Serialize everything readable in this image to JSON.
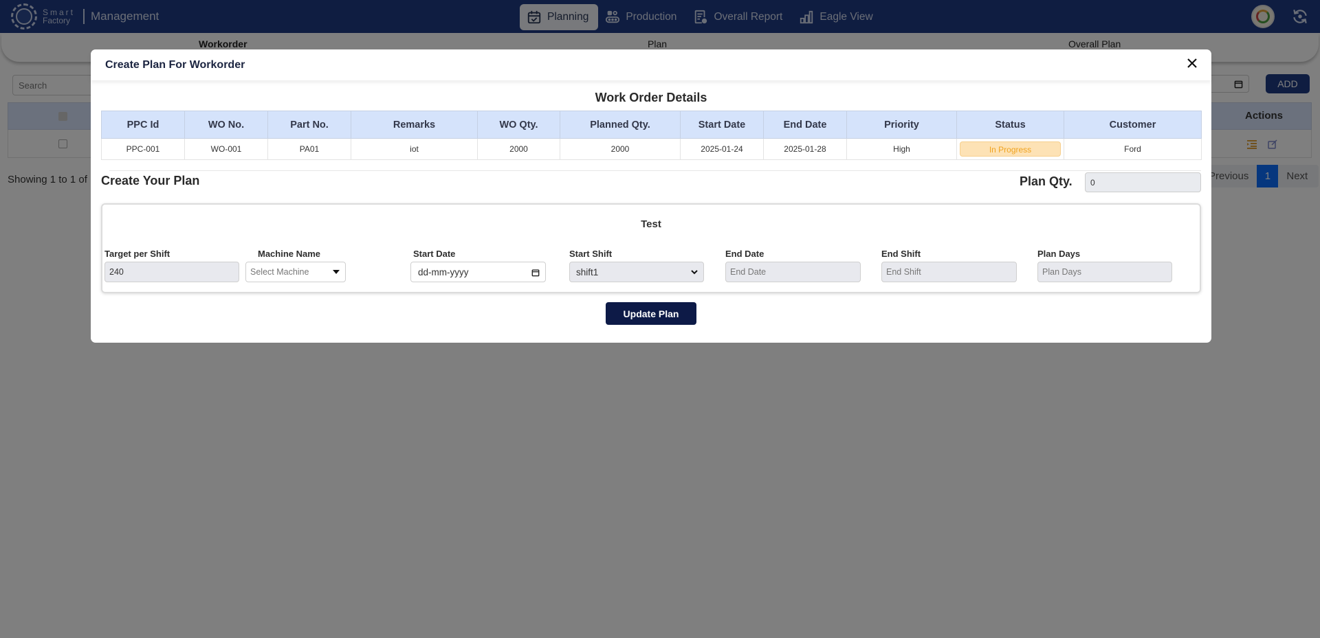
{
  "navbar": {
    "brand_line1": "Smart",
    "brand_line2": "Factory",
    "title": "Management",
    "tabs": [
      {
        "label": "Planning",
        "icon": "calendar-check-icon",
        "active": true
      },
      {
        "label": "Production",
        "icon": "conveyor-icon",
        "active": false
      },
      {
        "label": "Overall Report",
        "icon": "report-gear-icon",
        "active": false
      },
      {
        "label": "Eagle View",
        "icon": "bar-chart-icon",
        "active": false
      }
    ]
  },
  "background": {
    "subtabs": [
      {
        "label": "Workorder",
        "active": true
      },
      {
        "label": "Plan",
        "active": false
      },
      {
        "label": "Overall Plan",
        "active": false
      }
    ],
    "search_placeholder": "Search",
    "add_label": "ADD",
    "actions_header": "Actions",
    "showing_text": "Showing 1 to 1 of",
    "pager": {
      "previous": "Previous",
      "current": "1",
      "next": "Next"
    }
  },
  "modal": {
    "title": "Create Plan For Workorder",
    "work_order_title": "Work Order Details",
    "table": {
      "columns": [
        "PPC Id",
        "WO No.",
        "Part No.",
        "Remarks",
        "WO Qty.",
        "Planned Qty.",
        "Start Date",
        "End Date",
        "Priority",
        "Status",
        "Customer"
      ],
      "rows": [
        [
          "PPC-001",
          "WO-001",
          "PA01",
          "iot",
          "2000",
          "2000",
          "2025-01-24",
          "2025-01-28",
          "High",
          "In Progress",
          "Ford"
        ]
      ]
    },
    "create_title": "Create Your Plan",
    "plan_qty_label": "Plan Qty.",
    "plan_qty_value": "0",
    "card": {
      "title": "Test",
      "fields": {
        "target_per_shift": {
          "label": "Target per Shift",
          "value": "240"
        },
        "machine_name": {
          "label": "Machine Name",
          "placeholder": "Select Machine"
        },
        "start_date": {
          "label": "Start Date",
          "placeholder": "dd-mm-yyyy"
        },
        "start_shift": {
          "label": "Start Shift",
          "value": "shift1"
        },
        "end_date": {
          "label": "End Date",
          "placeholder": "End Date"
        },
        "end_shift": {
          "label": "End Shift",
          "placeholder": "End Shift"
        },
        "plan_days": {
          "label": "Plan Days",
          "placeholder": "Plan Days"
        }
      }
    },
    "update_label": "Update Plan"
  },
  "colors": {
    "navbar": "#1f3a82",
    "primary_button": "#0d1a47",
    "table_header": "#d5e3fb",
    "status_in_progress_bg": "#fde2b5",
    "status_in_progress_text": "#f0a31f",
    "pager_active": "#0d6efd"
  }
}
